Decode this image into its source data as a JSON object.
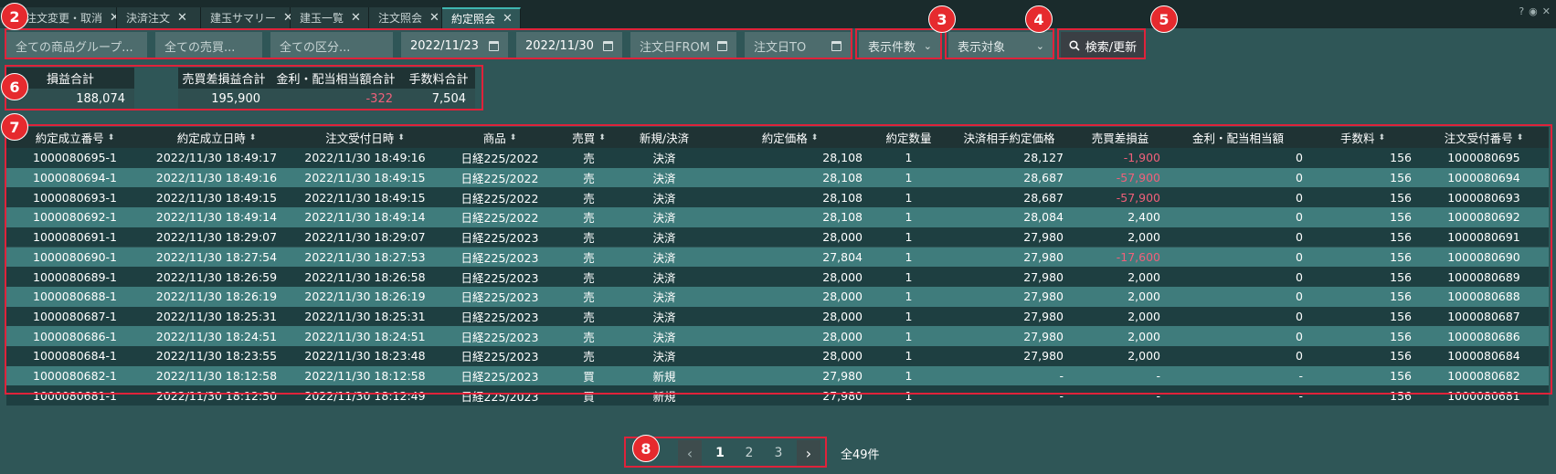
{
  "tabs": [
    {
      "label": "注文変更・取消",
      "active": false
    },
    {
      "label": "決済注文",
      "active": false
    },
    {
      "label": "建玉サマリー",
      "active": false
    },
    {
      "label": "建玉一覧",
      "active": false
    },
    {
      "label": "注文照会",
      "active": false
    },
    {
      "label": "約定照会",
      "active": true
    }
  ],
  "tab_close_glyph": "✕",
  "window_icons": [
    "?",
    "◉",
    "✕"
  ],
  "filters": {
    "product_group": "全ての商品グループ...",
    "buy_sell": "全ての売買...",
    "category": "全ての区分...",
    "date_from": "2022/11/23",
    "date_to": "2022/11/30",
    "order_date_from": "注文日FROM",
    "order_date_to": "注文日TO",
    "display_count": "表示件数",
    "display_target": "表示対象",
    "search_label": "検索/更新"
  },
  "badges": [
    "2",
    "3",
    "4",
    "5",
    "6",
    "7",
    "8"
  ],
  "summary": {
    "pl_total_label": "損益合計",
    "pl_total_value": "188,074",
    "trade_pl_label": "売買差損益合計",
    "trade_pl_value": "195,900",
    "interest_label": "金利・配当相当額合計",
    "interest_value": "-322",
    "fee_label": "手数料合計",
    "fee_value": "7,504"
  },
  "table": {
    "columns": [
      "約定成立番号",
      "約定成立日時",
      "注文受付日時",
      "商品",
      "売買",
      "新規/決済",
      "約定価格",
      "約定数量",
      "決済相手約定価格",
      "売買差損益",
      "金利・配当相当額",
      "手数料",
      "注文受付番号"
    ],
    "sortable": [
      true,
      true,
      true,
      true,
      true,
      false,
      true,
      false,
      false,
      false,
      false,
      true,
      true
    ],
    "sort_glyph": "⬍",
    "rows": [
      [
        "1000080695-1",
        "2022/11/30 18:49:17",
        "2022/11/30 18:49:16",
        "日経225/2022",
        "売",
        "決済",
        "28,108",
        "1",
        "28,127",
        "-1,900",
        "0",
        "156",
        "1000080695"
      ],
      [
        "1000080694-1",
        "2022/11/30 18:49:16",
        "2022/11/30 18:49:15",
        "日経225/2022",
        "売",
        "決済",
        "28,108",
        "1",
        "28,687",
        "-57,900",
        "0",
        "156",
        "1000080694"
      ],
      [
        "1000080693-1",
        "2022/11/30 18:49:15",
        "2022/11/30 18:49:15",
        "日経225/2022",
        "売",
        "決済",
        "28,108",
        "1",
        "28,687",
        "-57,900",
        "0",
        "156",
        "1000080693"
      ],
      [
        "1000080692-1",
        "2022/11/30 18:49:14",
        "2022/11/30 18:49:14",
        "日経225/2022",
        "売",
        "決済",
        "28,108",
        "1",
        "28,084",
        "2,400",
        "0",
        "156",
        "1000080692"
      ],
      [
        "1000080691-1",
        "2022/11/30 18:29:07",
        "2022/11/30 18:29:07",
        "日経225/2023",
        "売",
        "決済",
        "28,000",
        "1",
        "27,980",
        "2,000",
        "0",
        "156",
        "1000080691"
      ],
      [
        "1000080690-1",
        "2022/11/30 18:27:54",
        "2022/11/30 18:27:53",
        "日経225/2023",
        "売",
        "決済",
        "27,804",
        "1",
        "27,980",
        "-17,600",
        "0",
        "156",
        "1000080690"
      ],
      [
        "1000080689-1",
        "2022/11/30 18:26:59",
        "2022/11/30 18:26:58",
        "日経225/2023",
        "売",
        "決済",
        "28,000",
        "1",
        "27,980",
        "2,000",
        "0",
        "156",
        "1000080689"
      ],
      [
        "1000080688-1",
        "2022/11/30 18:26:19",
        "2022/11/30 18:26:19",
        "日経225/2023",
        "売",
        "決済",
        "28,000",
        "1",
        "27,980",
        "2,000",
        "0",
        "156",
        "1000080688"
      ],
      [
        "1000080687-1",
        "2022/11/30 18:25:31",
        "2022/11/30 18:25:31",
        "日経225/2023",
        "売",
        "決済",
        "28,000",
        "1",
        "27,980",
        "2,000",
        "0",
        "156",
        "1000080687"
      ],
      [
        "1000080686-1",
        "2022/11/30 18:24:51",
        "2022/11/30 18:24:51",
        "日経225/2023",
        "売",
        "決済",
        "28,000",
        "1",
        "27,980",
        "2,000",
        "0",
        "156",
        "1000080686"
      ],
      [
        "1000080684-1",
        "2022/11/30 18:23:55",
        "2022/11/30 18:23:48",
        "日経225/2023",
        "売",
        "決済",
        "28,000",
        "1",
        "27,980",
        "2,000",
        "0",
        "156",
        "1000080684"
      ],
      [
        "1000080682-1",
        "2022/11/30 18:12:58",
        "2022/11/30 18:12:58",
        "日経225/2023",
        "買",
        "新規",
        "27,980",
        "1",
        "-",
        "-",
        "-",
        "156",
        "1000080682"
      ],
      [
        "1000080681-1",
        "2022/11/30 18:12:50",
        "2022/11/30 18:12:49",
        "日経225/2023",
        "買",
        "新規",
        "27,980",
        "1",
        "-",
        "-",
        "-",
        "156",
        "1000080681"
      ]
    ]
  },
  "pagination": {
    "prev_glyph": "‹",
    "next_glyph": "›",
    "pages": [
      "1",
      "2",
      "3"
    ],
    "current": "1",
    "total": "全49件"
  },
  "colors": {
    "background": "#2f5657",
    "header_bg": "#1f3334",
    "row_odd": "#1e3f41",
    "row_even": "#3f7c7c",
    "negative": "#f0607a",
    "sell": "#36c9a4",
    "buy": "#f0607a",
    "highlight": "#e0223a"
  }
}
